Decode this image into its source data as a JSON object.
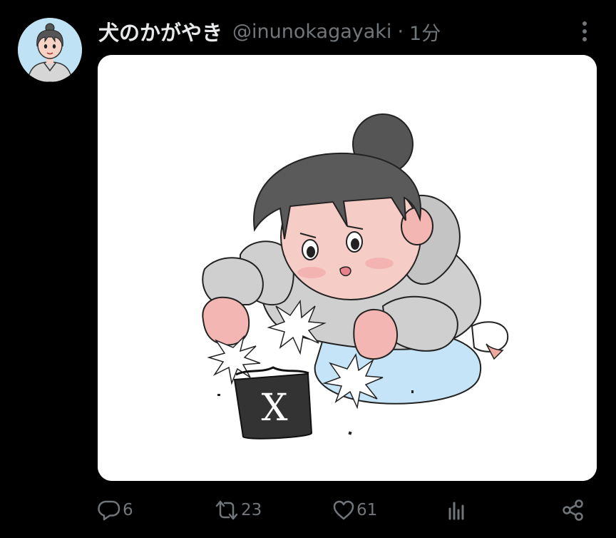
{
  "tweet": {
    "display_name": "犬のかがやき",
    "handle": "@inunokagayaki",
    "separator": "·",
    "timestamp": "1分",
    "media": {
      "logo_letter": "X"
    },
    "actions": {
      "reply_count": "6",
      "retweet_count": "23",
      "like_count": "61"
    }
  },
  "colors": {
    "background": "#000000",
    "primary_text": "#e7e9ea",
    "secondary_text": "#71767b",
    "media_background": "#ffffff"
  },
  "icons": {
    "avatar": "girl-avatar-illustration",
    "more": "more-vertical-icon",
    "reply": "reply-icon",
    "retweet": "retweet-icon",
    "like": "heart-icon",
    "views": "analytics-icon",
    "share": "share-icon"
  }
}
